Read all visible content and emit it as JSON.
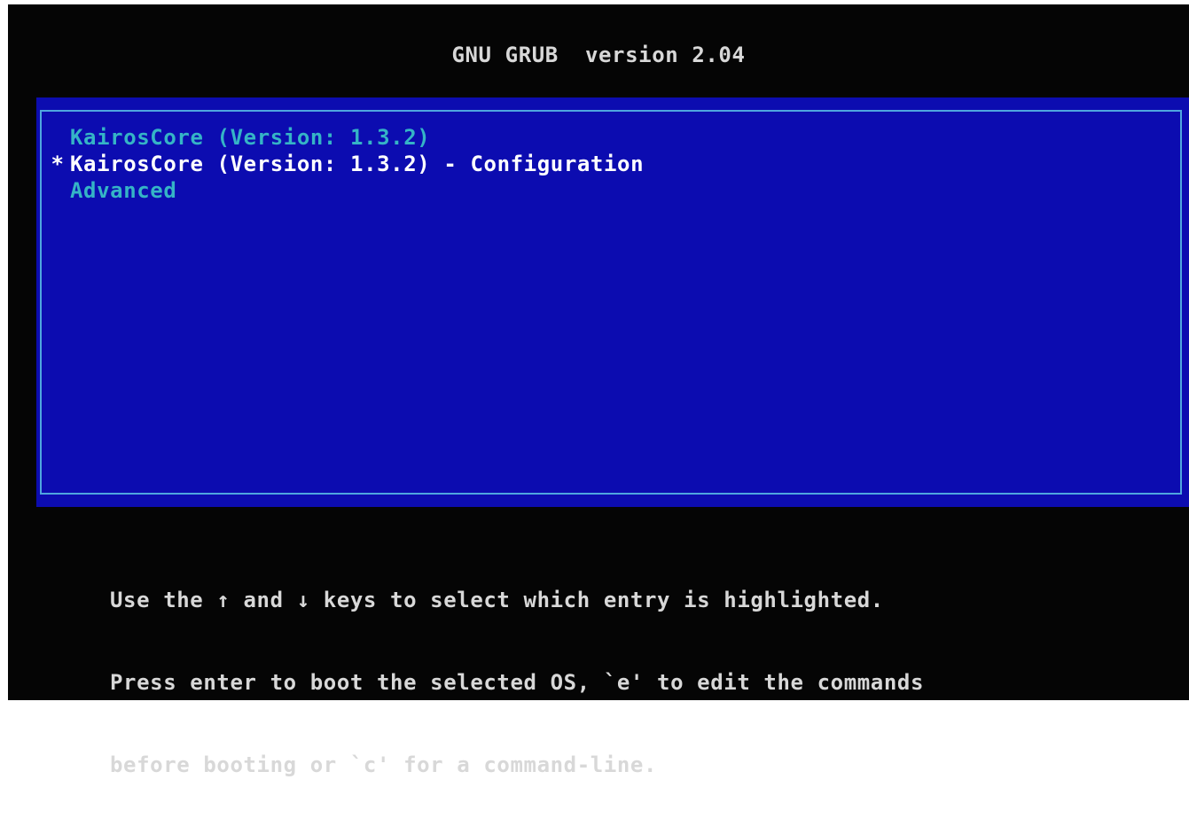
{
  "header": {
    "title": "GNU GRUB  version 2.04"
  },
  "menu": {
    "selected_marker": "*",
    "items": [
      {
        "label": "KairosCore (Version: 1.3.2)",
        "selected": false
      },
      {
        "label": "KairosCore (Version: 1.3.2) - Configuration",
        "selected": true
      },
      {
        "label": "Advanced",
        "selected": false
      }
    ]
  },
  "help": {
    "lines": [
      "Use the ↑ and ↓ keys to select which entry is highlighted.",
      "Press enter to boot the selected OS, `e' to edit the commands",
      "before booting or `c' for a command-line."
    ]
  },
  "colors": {
    "background": "#050505",
    "menu_background": "#0c0cb0",
    "menu_border": "#4fa6df",
    "entry_normal": "#35b4c6",
    "entry_highlighted": "#ffffff",
    "text": "#d8d8d8"
  }
}
